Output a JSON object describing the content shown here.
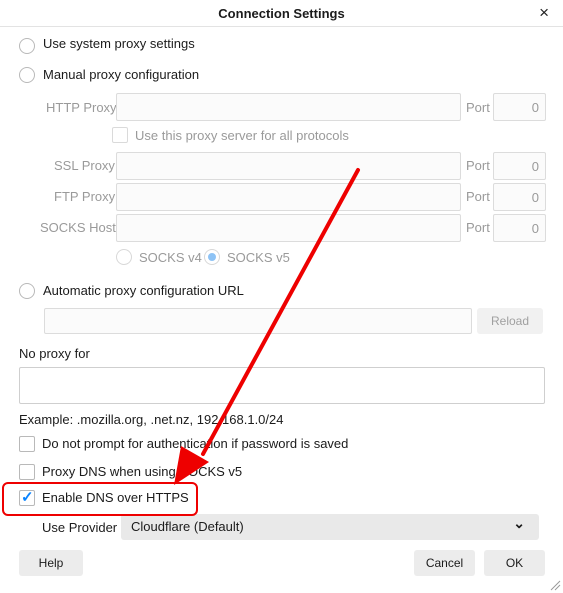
{
  "window": {
    "title": "Connection Settings",
    "close_glyph": "×"
  },
  "options": {
    "system_proxy": "Use system proxy settings",
    "manual_proxy": "Manual proxy configuration",
    "auto_url": "Automatic proxy configuration URL"
  },
  "http": {
    "label": "HTTP Proxy",
    "port_label": "Port",
    "port_value": "0"
  },
  "all_protocols": "Use this proxy server for all protocols",
  "ssl": {
    "label": "SSL Proxy",
    "port_label": "Port",
    "port_value": "0"
  },
  "ftp": {
    "label": "FTP Proxy",
    "port_label": "Port",
    "port_value": "0"
  },
  "socks": {
    "label": "SOCKS Host",
    "port_label": "Port",
    "port_value": "0",
    "v4": "SOCKS v4",
    "v5": "SOCKS v5"
  },
  "reload_label": "Reload",
  "no_proxy": {
    "label": "No proxy for",
    "example": "Example: .mozilla.org, .net.nz, 192.168.1.0/24"
  },
  "checkboxes": {
    "no_prompt": "Do not prompt for authentication if password is saved",
    "proxy_dns": "Proxy DNS when using SOCKS v5",
    "dns_https": "Enable DNS over HTTPS"
  },
  "provider": {
    "label": "Use Provider",
    "value": "Cloudflare (Default)",
    "chevron": "⌄"
  },
  "buttons": {
    "help": "Help",
    "cancel": "Cancel",
    "ok": "OK"
  },
  "colors": {
    "accent": "#0a84ff",
    "annotation": "#e00000"
  }
}
